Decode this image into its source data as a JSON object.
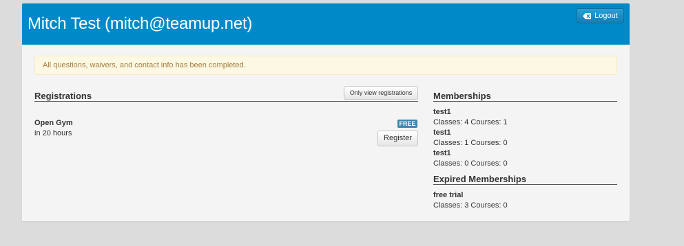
{
  "header": {
    "title": "Mitch Test (mitch@teamup.net)",
    "logout_label": "Logout",
    "logout_icon": "backspace-x-icon",
    "background": "#0089c8"
  },
  "notice": {
    "text": "All questions, waivers, and contact info has been completed."
  },
  "registrations": {
    "title": "Registrations",
    "filter_button": "Only view registrations",
    "items": [
      {
        "name": "Open Gym",
        "when": "in 20 hours",
        "badge": "FREE",
        "action": "Register"
      }
    ]
  },
  "memberships": {
    "title": "Memberships",
    "items": [
      {
        "name": "test1",
        "detail": "Classes: 4 Courses: 1"
      },
      {
        "name": "test1",
        "detail": "Classes: 1 Courses: 0"
      },
      {
        "name": "test1",
        "detail": "Classes: 0 Courses: 0"
      }
    ]
  },
  "expired_memberships": {
    "title": "Expired Memberships",
    "items": [
      {
        "name": "free trial",
        "detail": "Classes: 3 Courses: 0"
      }
    ]
  }
}
